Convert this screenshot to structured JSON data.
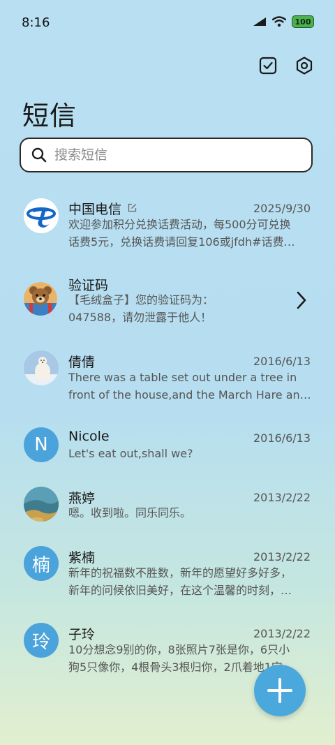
{
  "status_bar": {
    "time": "8:16",
    "battery_level": "100",
    "icons": [
      "cell-signal-icon",
      "wifi-icon",
      "battery-icon"
    ]
  },
  "header": {
    "title": "短信",
    "actions": [
      "select-checkbox-icon",
      "settings-gear-icon"
    ]
  },
  "search": {
    "placeholder": "搜索短信"
  },
  "conversations": [
    {
      "name": "中国电信",
      "date": "2025/9/30",
      "line1": "欢迎参加积分兑换话费活动，每500分可兑换",
      "line2": "话费5元，兑换话费请回复106或jfdh#话费…",
      "avatar": "china-telecom-logo"
    },
    {
      "name": "验证码",
      "date": "",
      "line1": "【毛绒盒子】您的验证码为：",
      "line2": "047588，请勿泄露于他人！",
      "avatar": "teddy-bear-photo"
    },
    {
      "name": "倩倩",
      "date": "2016/6/13",
      "line1": "There was a table set out under a tree in",
      "line2": "front of the house,and the March Hare an…",
      "avatar": "polar-bear-photo"
    },
    {
      "name": "Nicole",
      "date": "2016/6/13",
      "line1": "Let's eat out,shall we?",
      "line2": "",
      "avatar_letter": "N"
    },
    {
      "name": "燕婷",
      "date": "2013/2/22",
      "line1": "嗯。收到啦。同乐同乐。",
      "line2": "",
      "avatar": "landscape-photo"
    },
    {
      "name": "紫楠",
      "date": "2013/2/22",
      "line1": "新年的祝福数不胜数，新年的愿望好多好多，",
      "line2": "新年的问候依旧美好，在这个温馨的时刻，…",
      "avatar_letter": "楠"
    },
    {
      "name": "子玲",
      "date": "2013/2/22",
      "line1": "10分想念9别的你，8张照片7张是你，6只小",
      "line2": "狗5只像你，4根骨头3根归你，2爪着地1宝…",
      "avatar_letter": "玲"
    }
  ],
  "fab": {
    "icon": "plus-icon"
  },
  "colors": {
    "accent": "#4aa8dc",
    "avatar_blue": "#4aa3db",
    "battery_green": "#4caf50"
  }
}
